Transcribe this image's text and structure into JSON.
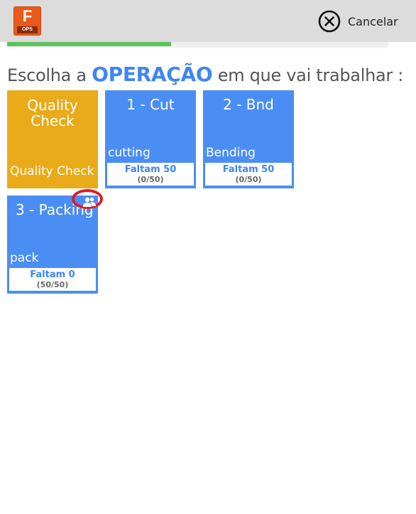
{
  "app": {
    "logo_letter": "F",
    "logo_sub": "OPS"
  },
  "header": {
    "cancel_label": "Cancelar",
    "cancel_icon": "close-circle-icon"
  },
  "progress": {
    "fraction": 0.43,
    "color": "#5cc15e"
  },
  "heading": {
    "prefix": "Escolha a ",
    "keyword": "OPERAÇÃO",
    "suffix": " em que vai trabalhar :"
  },
  "operations": [
    {
      "title_line1": "Quality",
      "title_line2": "Check",
      "description": "Quality Check",
      "color": "#e9ab1a"
    },
    {
      "title": "1 - Cut",
      "description": "cutting",
      "remaining": "Faltam 50",
      "count": "(0/50)",
      "color": "#4b8ef3"
    },
    {
      "title": "2 - Bnd",
      "description": "Bending",
      "remaining": "Faltam 50",
      "count": "(0/50)",
      "color": "#4b8ef3"
    },
    {
      "title": "3 - Packing",
      "description": "pack",
      "remaining": "Faltam 0",
      "count": "(50/50)",
      "color": "#4b8ef3",
      "badge_icon": "users-icon"
    }
  ],
  "colors": {
    "accent": "#3d86f3",
    "highlight_marker": "#e11a2a",
    "topbar": "#dcdcdc"
  }
}
